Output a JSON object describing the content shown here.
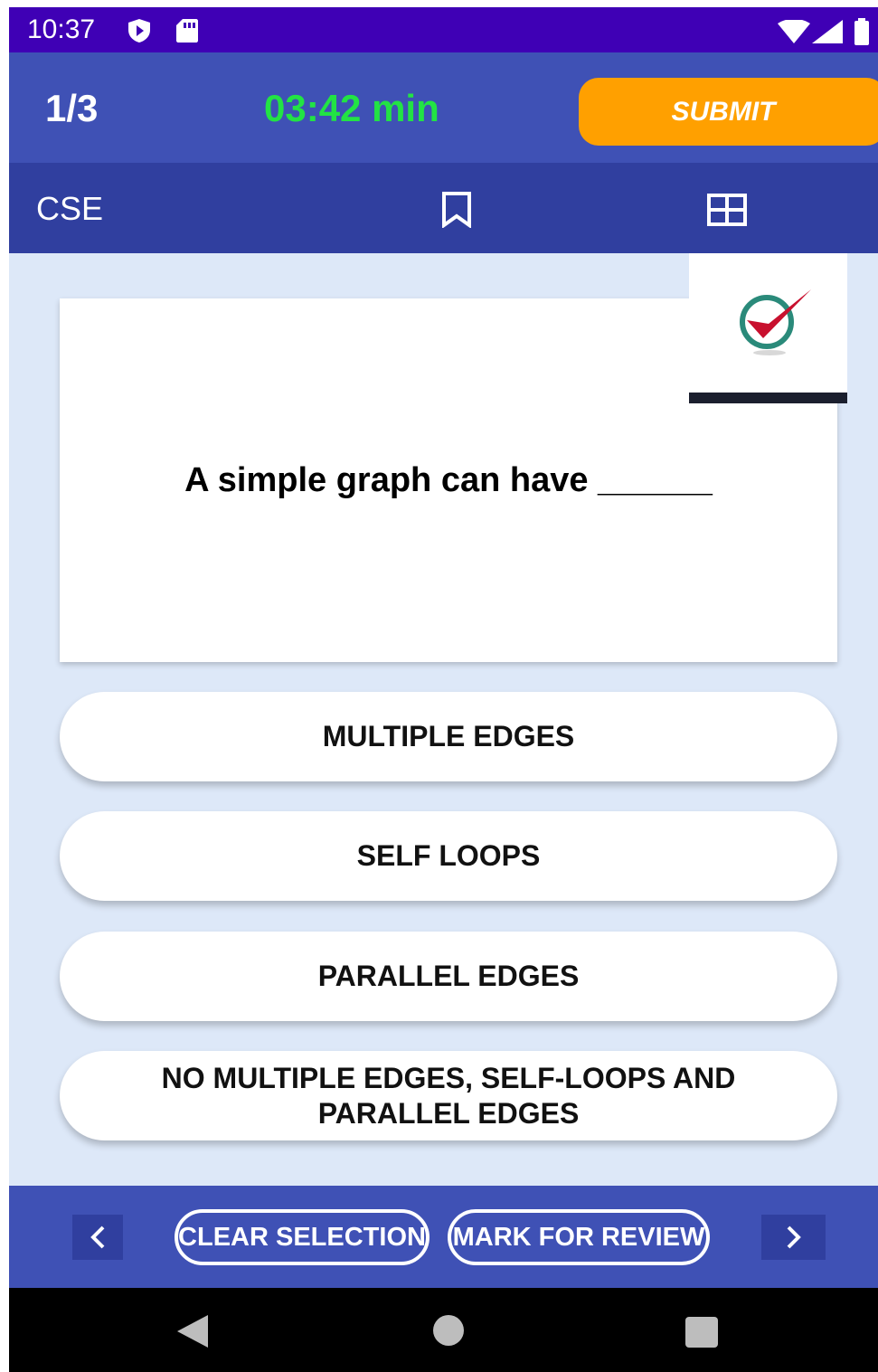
{
  "status_bar": {
    "time": "10:37",
    "icons": [
      "play-protect-icon",
      "sd-card-icon",
      "wifi-icon",
      "signal-icon",
      "battery-icon"
    ]
  },
  "header": {
    "question_counter": "1/3",
    "timer": "03:42 min",
    "submit_label": "SUBMIT",
    "subject": "CSE",
    "icons": [
      "bookmark-icon",
      "grid-view-icon"
    ]
  },
  "question": {
    "text": "A simple graph can have ______"
  },
  "options": [
    {
      "label": "MULTIPLE EDGES"
    },
    {
      "label": "SELF LOOPS"
    },
    {
      "label": "PARALLEL EDGES"
    },
    {
      "label": "NO MULTIPLE EDGES, SELF-LOOPS AND PARALLEL EDGES"
    }
  ],
  "footer": {
    "clear_label": "CLEAR SELECTION",
    "review_label": "MARK FOR REVIEW",
    "prev_icon": "chevron-left-icon",
    "next_icon": "chevron-right-icon"
  },
  "colors": {
    "status_bar": "#3f00b5",
    "primary": "#3f51b5",
    "primary_dark": "#303f9f",
    "accent": "#ffa000",
    "timer": "#22e344",
    "background": "#dde8f8"
  }
}
